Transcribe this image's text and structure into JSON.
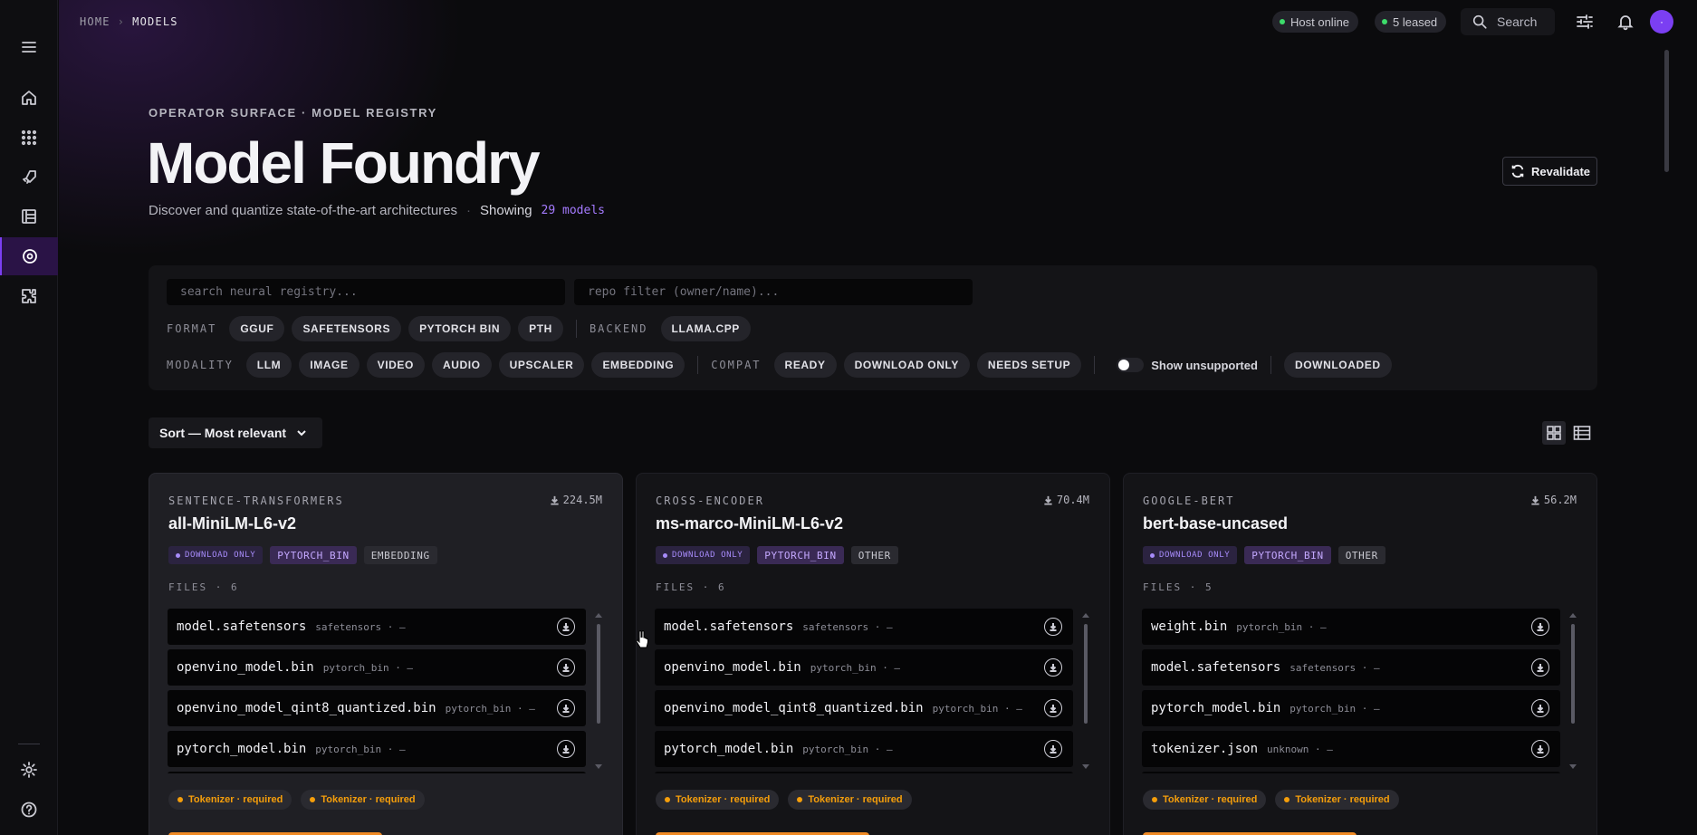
{
  "breadcrumb": {
    "home": "HOME",
    "current": "MODELS"
  },
  "status": {
    "host": "Host online",
    "leased": "5 leased"
  },
  "search": {
    "label": "Search"
  },
  "header": {
    "eyebrow": "OPERATOR SURFACE · MODEL REGISTRY",
    "title": "Model Foundry",
    "subtitle": "Discover and quantize state-of-the-art architectures",
    "showing_label": "Showing",
    "showing_count": "29 models",
    "revalidate": "Revalidate"
  },
  "filters": {
    "search_placeholder": "search neural registry...",
    "repo_placeholder": "repo filter (owner/name)...",
    "format_label": "FORMAT",
    "formats": [
      "GGUF",
      "SAFETENSORS",
      "PYTORCH BIN",
      "PTH"
    ],
    "backend_label": "BACKEND",
    "backends": [
      "LLAMA.CPP"
    ],
    "modality_label": "MODALITY",
    "modalities": [
      "LLM",
      "IMAGE",
      "VIDEO",
      "AUDIO",
      "UPSCALER",
      "EMBEDDING"
    ],
    "compat_label": "COMPAT",
    "compat": [
      "READY",
      "DOWNLOAD ONLY",
      "NEEDS SETUP"
    ],
    "show_unsupported": "Show unsupported",
    "downloaded": "DOWNLOADED"
  },
  "sort": {
    "label": "Sort — Most relevant"
  },
  "cards": [
    {
      "org": "SENTENCE-TRANSFORMERS",
      "downloads": "224.5M",
      "name": "all-MiniLM-L6-v2",
      "status": "DOWNLOAD ONLY",
      "format": "PYTORCH_BIN",
      "kind": "EMBEDDING",
      "files_label": "FILES · 6",
      "files": [
        {
          "name": "model.safetensors",
          "meta": "safetensors · —"
        },
        {
          "name": "openvino_model.bin",
          "meta": "pytorch_bin · —"
        },
        {
          "name": "openvino_model_qint8_quantized.bin",
          "meta": "pytorch_bin · —"
        },
        {
          "name": "pytorch_model.bin",
          "meta": "pytorch_bin · —"
        }
      ],
      "warnings": [
        "Tokenizer · required",
        "Tokenizer · required"
      ]
    },
    {
      "org": "CROSS-ENCODER",
      "downloads": "70.4M",
      "name": "ms-marco-MiniLM-L6-v2",
      "status": "DOWNLOAD ONLY",
      "format": "PYTORCH_BIN",
      "kind": "OTHER",
      "files_label": "FILES · 6",
      "files": [
        {
          "name": "model.safetensors",
          "meta": "safetensors · —"
        },
        {
          "name": "openvino_model.bin",
          "meta": "pytorch_bin · —"
        },
        {
          "name": "openvino_model_qint8_quantized.bin",
          "meta": "pytorch_bin · —"
        },
        {
          "name": "pytorch_model.bin",
          "meta": "pytorch_bin · —"
        }
      ],
      "warnings": [
        "Tokenizer · required",
        "Tokenizer · required"
      ]
    },
    {
      "org": "GOOGLE-BERT",
      "downloads": "56.2M",
      "name": "bert-base-uncased",
      "status": "DOWNLOAD ONLY",
      "format": "PYTORCH_BIN",
      "kind": "OTHER",
      "files_label": "FILES · 5",
      "files": [
        {
          "name": "weight.bin",
          "meta": "pytorch_bin · —"
        },
        {
          "name": "model.safetensors",
          "meta": "safetensors · —"
        },
        {
          "name": "pytorch_model.bin",
          "meta": "pytorch_bin · —"
        },
        {
          "name": "tokenizer.json",
          "meta": "unknown · —"
        }
      ],
      "warnings": [
        "Tokenizer · required",
        "Tokenizer · required"
      ]
    }
  ]
}
